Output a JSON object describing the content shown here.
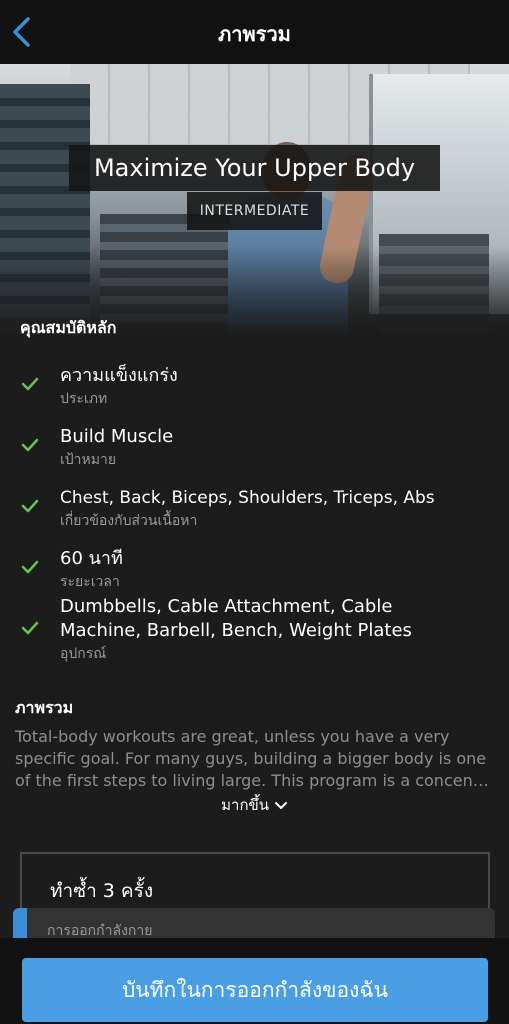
{
  "header": {
    "title": "ภาพรวม",
    "back_icon": "chevron-left-icon"
  },
  "hero": {
    "title": "Maximize Your Upper Body",
    "level": "INTERMEDIATE"
  },
  "features": {
    "heading": "คุณสมบัติหลัก",
    "items": [
      {
        "main": "ความแข็งแกร่ง",
        "sub": "ประเภท"
      },
      {
        "main": "Build Muscle",
        "sub": "เป้าหมาย"
      },
      {
        "main": "Chest, Back, Biceps, Shoulders, Triceps, Abs",
        "sub": "เกี่ยวข้องกับส่วนเนื้อหา"
      },
      {
        "main": "60 นาที",
        "sub": "ระยะเวลา"
      },
      {
        "main_line1": "Dumbbells, Cable Attachment, Cable",
        "main_line2": "Machine, Barbell, Bench, Weight Plates",
        "sub": "อุปกรณ์"
      }
    ]
  },
  "overview": {
    "heading": "ภาพรวม",
    "text": "Total-body workouts are great, unless you have a very specific goal. For many guys, building a bigger body is one of the first steps to living large. This program is a concen…",
    "more": "มากขึ้น"
  },
  "schedule": {
    "reps_title": "ทำซ้ำ 3 ครั้ง",
    "exercise_label": "การออกกำลังกาย"
  },
  "footer": {
    "save_label": "บันทึกในการออกกำลังของฉัน"
  },
  "colors": {
    "accent": "#4a9ee3",
    "check": "#6cc24a",
    "background": "#1c1c1c"
  }
}
